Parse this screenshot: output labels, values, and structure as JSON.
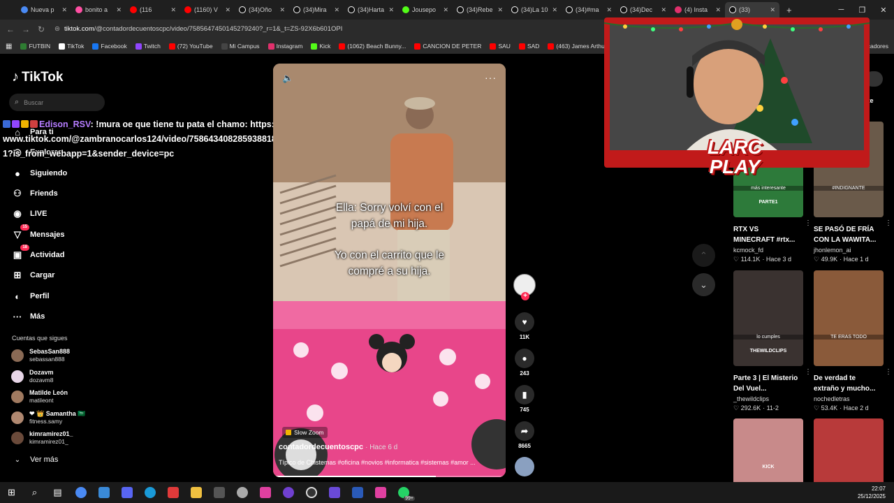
{
  "browser": {
    "tabs": [
      {
        "title": "Nueva p",
        "icon": "chrome-icon",
        "color": "#4a8af4"
      },
      {
        "title": "bonito a",
        "icon": "app-icon",
        "color": "#ff4fa3"
      },
      {
        "title": "(116",
        "icon": "youtube-icon",
        "color": "#ff0000"
      },
      {
        "title": "(1160) V",
        "icon": "youtube-icon",
        "color": "#ff0000"
      },
      {
        "title": "(34)Oño",
        "icon": "tiktok-icon",
        "color": "#ffffff"
      },
      {
        "title": "(34)Mira",
        "icon": "tiktok-icon",
        "color": "#ffffff"
      },
      {
        "title": "(34)Harta",
        "icon": "tiktok-icon",
        "color": "#ffffff"
      },
      {
        "title": "Jousepo",
        "icon": "kick-icon",
        "color": "#53fc18"
      },
      {
        "title": "(34)Rebe",
        "icon": "tiktok-icon",
        "color": "#ffffff"
      },
      {
        "title": "(34)La 10",
        "icon": "tiktok-icon",
        "color": "#ffffff"
      },
      {
        "title": "(34)#ma",
        "icon": "tiktok-icon",
        "color": "#ffffff"
      },
      {
        "title": "(34)Dec",
        "icon": "tiktok-icon",
        "color": "#ffffff"
      },
      {
        "title": "(4) Insta",
        "icon": "instagram-icon",
        "color": "#e1306c"
      },
      {
        "title": "(33)",
        "icon": "tiktok-icon",
        "color": "#ffffff"
      }
    ],
    "url_domain": "tiktok.com",
    "url_path": "/@contadordecuentoscpc/video/7585647450145279240?_r=1&_t=ZS-92X6b601OPI",
    "bookmarks": [
      {
        "label": "FUTBIN",
        "color": "#2e7d32"
      },
      {
        "label": "TikTok",
        "color": "#ffffff"
      },
      {
        "label": "Facebook",
        "color": "#1877f2"
      },
      {
        "label": "Twitch",
        "color": "#9146ff"
      },
      {
        "label": "(72) YouTube",
        "color": "#ff0000"
      },
      {
        "label": "Mi Campus",
        "color": "#444444"
      },
      {
        "label": "Instagram",
        "color": "#e1306c"
      },
      {
        "label": "Kick",
        "color": "#53fc18"
      },
      {
        "label": "(1062) Beach Bunny...",
        "color": "#ff0000"
      },
      {
        "label": "CANCION DE PETER",
        "color": "#ff0000"
      },
      {
        "label": "SAU",
        "color": "#ff0000"
      },
      {
        "label": "SAD",
        "color": "#ff0000"
      },
      {
        "label": "(463) James Arthur -...",
        "color": "#ff0000"
      }
    ],
    "bookmarks_right": "cadores"
  },
  "sidebar": {
    "logo": "TikTok",
    "search_placeholder": "Buscar",
    "items": [
      {
        "label": "Para ti",
        "icon": "home-icon",
        "badge": ""
      },
      {
        "label": "Explorar",
        "icon": "compass-icon",
        "badge": ""
      },
      {
        "label": "Siguiendo",
        "icon": "following-icon",
        "badge": ""
      },
      {
        "label": "Friends",
        "icon": "friends-icon",
        "badge": ""
      },
      {
        "label": "LIVE",
        "icon": "live-icon",
        "badge": ""
      },
      {
        "label": "Mensajes",
        "icon": "messages-icon",
        "badge": "15"
      },
      {
        "label": "Actividad",
        "icon": "activity-icon",
        "badge": "18"
      },
      {
        "label": "Cargar",
        "icon": "upload-icon",
        "badge": ""
      },
      {
        "label": "Perfil",
        "icon": "profile-icon",
        "badge": ""
      },
      {
        "label": "Más",
        "icon": "more-icon",
        "badge": ""
      }
    ],
    "following_header": "Cuentas que sigues",
    "accounts": [
      {
        "name": "SebasSan888",
        "handle": "sebassan888",
        "color": "#8a6a55"
      },
      {
        "name": "Dozavm",
        "handle": "dozavm8",
        "color": "#e8d6e8"
      },
      {
        "name": "Matilde León",
        "handle": "matileont",
        "color": "#a07a60"
      },
      {
        "name": "❤ 👑 Samantha 🇸🇦",
        "handle": "fitness.samy",
        "color": "#b08870"
      },
      {
        "name": "kimramirez01_",
        "handle": "kimramirez01_",
        "color": "#6a4a3a"
      }
    ],
    "see_more": "Ver más"
  },
  "chat_overlay": {
    "username": "Edison_RSV",
    "message": ": !mura oe que tiene tu pata el chamo: https://www.tiktok.com/@zambranocarlos124/video/7586434082859388181?is_from_webapp=1&sender_device=pc"
  },
  "video": {
    "caption_line1": "Ella: Sorry volví con el",
    "caption_line2": "papá de mi hija.",
    "caption_line3": "Yo con el carrito que le",
    "caption_line4": "compré a su hija.",
    "effect": "Slow Zoom",
    "author": "contadordecuentoscpc",
    "ago": "· Hace 6 d",
    "description": "Típico de Chistemas #oficina #novios #informatica #sistemas #amor ...",
    "progress": 0.7
  },
  "actions": {
    "likes": "11K",
    "comments": "243",
    "saves": "745",
    "shares": "8665"
  },
  "webcam": {
    "brand_line1": "LARC",
    "brand_line2": "PLAY"
  },
  "right_header": "arte",
  "grid": [
    {
      "title": "RTX VS MINECRAFT #rtx...",
      "author": "kcmock_fd",
      "views": "♡ 114.1K",
      "ago": "· Hace 3 d",
      "overlay": "más interesante",
      "overlay2": "PARTE1",
      "bg": "#2d7a3a"
    },
    {
      "title": "SE PASÓ DE FRÍA CON LA WAWITA...",
      "author": "jhonlemon_ai",
      "views": "♡ 49.9K",
      "ago": "· Hace 1 d",
      "overlay": "#INDIGNANTE",
      "overlay2": "",
      "bg": "#6a5a4a"
    },
    {
      "title": "Parte 3 | El Misterio Del Vuel...",
      "author": "_thewildclips",
      "views": "♡ 292.6K",
      "ago": "· 11-2",
      "overlay": "lo cumples",
      "overlay2": "THEWILDCLIPS",
      "bg": "#3a3230"
    },
    {
      "title": "De verdad te extraño y mucho...",
      "author": "nochedletras",
      "views": "♡ 53.4K",
      "ago": "· Hace 2 d",
      "overlay": "TE ERAS TODO",
      "overlay2": "",
      "bg": "#8a5a3a"
    },
    {
      "title": "",
      "author": "",
      "views": "",
      "ago": "",
      "overlay": "",
      "overlay2": "KICK",
      "bg": "#c88a8a"
    },
    {
      "title": "",
      "author": "",
      "views": "",
      "ago": "",
      "overlay": "",
      "overlay2": "",
      "bg": "#b83a3a"
    }
  ],
  "taskbar": {
    "time": "22:07",
    "date": "25/12/2025",
    "badge": "99+"
  }
}
